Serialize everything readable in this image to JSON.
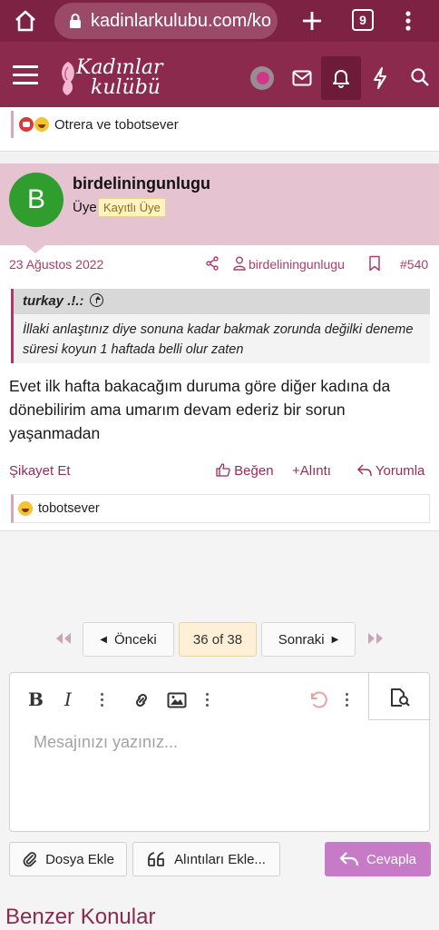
{
  "browser": {
    "url": "kadinlarkulubu.com/ko",
    "tab_count": "9"
  },
  "site": {
    "logo_line1": "Kadınlar",
    "logo_line2": "kulübü",
    "colors": {
      "primary": "#8b2a4d",
      "accent": "#c77bc6"
    }
  },
  "previous_post": {
    "reactions_text": "Otrera ve tobotsever"
  },
  "post": {
    "avatar_letter": "B",
    "username": "birdeliningunlugu",
    "role": "Üye",
    "badge": "Kayıtlı Üye",
    "date": "23 Ağustos 2022",
    "author_link": "birdeliningunlugu",
    "number": "#540",
    "quote": {
      "author": "turkay .!.:",
      "text": "İllaki anlaştınız diye sonuna kadar bakmak zorunda değilki deneme süresi koyun 1 haftada belli olur zaten"
    },
    "body": "Evet ilk hafta bakacağım duruma göre diğer kadına da dönebilirim ama umarım devam ederiz bir sorun yaşanmadan",
    "actions": {
      "report": "Şikayet Et",
      "like": "Beğen",
      "quote": "Alıntı",
      "reply": "Yorumla"
    },
    "reactions_text": "tobotsever"
  },
  "pagination": {
    "prev": "Önceki",
    "current": "36 of 38",
    "next": "Sonraki"
  },
  "editor": {
    "placeholder": "Mesajınızı yazınız...",
    "attach_label": "Dosya Ekle",
    "insert_quotes_label": "Alıntıları Ekle...",
    "reply_label": "Cevapla"
  },
  "similar_threads_heading": "Benzer Konular"
}
